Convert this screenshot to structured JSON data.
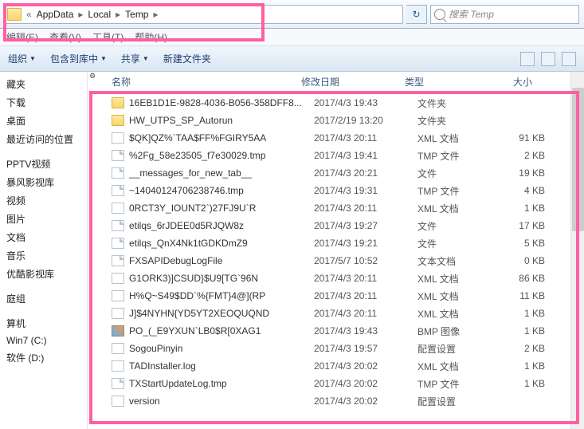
{
  "breadcrumb": {
    "pre": "«",
    "items": [
      "AppData",
      "Local",
      "Temp"
    ],
    "sep": "▸"
  },
  "search": {
    "placeholder": "搜索 Temp"
  },
  "menubar": [
    "编辑(E)",
    "查看(V)",
    "工具(T)",
    "帮助(H)"
  ],
  "toolbar": {
    "organize": "组织",
    "include": "包含到库中",
    "share": "共享",
    "newfolder": "新建文件夹",
    "drop": "▼"
  },
  "nav": {
    "fav": [
      "藏夹",
      "下载",
      "桌面",
      "最近访问的位置"
    ],
    "lib": [
      "PPTV视频",
      "暴风影视库",
      "视频",
      "图片",
      "文档",
      "音乐",
      "优酷影视库"
    ],
    "grp": [
      "庭组"
    ],
    "comp": [
      "算机",
      "Win7 (C:)",
      "软件 (D:)"
    ]
  },
  "columns": {
    "name": "名称",
    "date": "修改日期",
    "type": "类型",
    "size": "大小"
  },
  "files": [
    {
      "icon": "folder",
      "name": "16EB1D1E-9828-4036-B056-358DFF8...",
      "date": "2017/4/3 19:43",
      "type": "文件夹",
      "size": ""
    },
    {
      "icon": "folder",
      "name": "HW_UTPS_SP_Autorun",
      "date": "2017/2/19 13:20",
      "type": "文件夹",
      "size": ""
    },
    {
      "icon": "xml",
      "name": "$QK]QZ%`TAA$FF%FGIRY5AA",
      "date": "2017/4/3 20:11",
      "type": "XML 文档",
      "size": "91 KB"
    },
    {
      "icon": "file",
      "name": "%2Fg_58e23505_f7e30029.tmp",
      "date": "2017/4/3 19:41",
      "type": "TMP 文件",
      "size": "2 KB"
    },
    {
      "icon": "file",
      "name": "__messages_for_new_tab__",
      "date": "2017/4/3 20:21",
      "type": "文件",
      "size": "19 KB"
    },
    {
      "icon": "file",
      "name": "~14040124706238746.tmp",
      "date": "2017/4/3 19:31",
      "type": "TMP 文件",
      "size": "4 KB"
    },
    {
      "icon": "xml",
      "name": "0RCT3Y_IOUNT2`)27FJ9U`R",
      "date": "2017/4/3 20:11",
      "type": "XML 文档",
      "size": "1 KB"
    },
    {
      "icon": "file",
      "name": "etilqs_6rJDEE0d5RJQW8z",
      "date": "2017/4/3 19:27",
      "type": "文件",
      "size": "17 KB"
    },
    {
      "icon": "file",
      "name": "etilqs_QnX4Nk1tGDKDmZ9",
      "date": "2017/4/3 19:21",
      "type": "文件",
      "size": "5 KB"
    },
    {
      "icon": "file",
      "name": "FXSAPIDebugLogFile",
      "date": "2017/5/7 10:52",
      "type": "文本文档",
      "size": "0 KB"
    },
    {
      "icon": "xml",
      "name": "G1ORK3)]CSUD}$U9[TG`96N",
      "date": "2017/4/3 20:11",
      "type": "XML 文档",
      "size": "86 KB"
    },
    {
      "icon": "xml",
      "name": "H%Q~S49$DD`%{FMT}4@](RP",
      "date": "2017/4/3 20:11",
      "type": "XML 文档",
      "size": "11 KB"
    },
    {
      "icon": "xml",
      "name": "J]$4NYHN{YD5YT2XEOQUQND",
      "date": "2017/4/3 20:11",
      "type": "XML 文档",
      "size": "1 KB"
    },
    {
      "icon": "bmp",
      "name": "PO_(_E9YXUN`LB0$R[0XAG1",
      "date": "2017/4/3 19:43",
      "type": "BMP 图像",
      "size": "1 KB"
    },
    {
      "icon": "cfg",
      "name": "SogouPinyin",
      "date": "2017/4/3 19:57",
      "type": "配置设置",
      "size": "2 KB"
    },
    {
      "icon": "xml",
      "name": "TADInstaller.log",
      "date": "2017/4/3 20:02",
      "type": "XML 文档",
      "size": "1 KB"
    },
    {
      "icon": "file",
      "name": "TXStartUpdateLog.tmp",
      "date": "2017/4/3 20:02",
      "type": "TMP 文件",
      "size": "1 KB"
    },
    {
      "icon": "cfg",
      "name": "version",
      "date": "2017/4/3 20:02",
      "type": "配置设置",
      "size": ""
    }
  ]
}
